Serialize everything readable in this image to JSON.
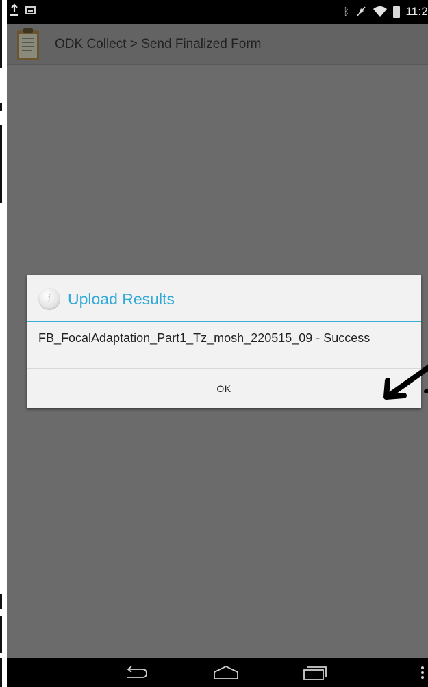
{
  "status_bar": {
    "time": "11:2",
    "icons": [
      "upload-icon",
      "image-icon",
      "bluetooth-icon",
      "mute-icon",
      "wifi-icon",
      "battery-icon"
    ]
  },
  "action_bar": {
    "title": "ODK Collect > Send Finalized Form",
    "logo": "clipboard-icon"
  },
  "dialog": {
    "title": "Upload Results",
    "icon": "info-icon",
    "message": "FB_FocalAdaptation_Part1_Tz_mosh_220515_09 - Success",
    "ok_label": "OK"
  },
  "nav_bar": {
    "icons": [
      "back-icon",
      "home-icon",
      "recent-apps-icon",
      "overflow-menu-icon"
    ]
  },
  "colors": {
    "accent": "#31a9d8",
    "dim_background": "#6b6b6b",
    "dialog_background": "#f2f2f2"
  }
}
